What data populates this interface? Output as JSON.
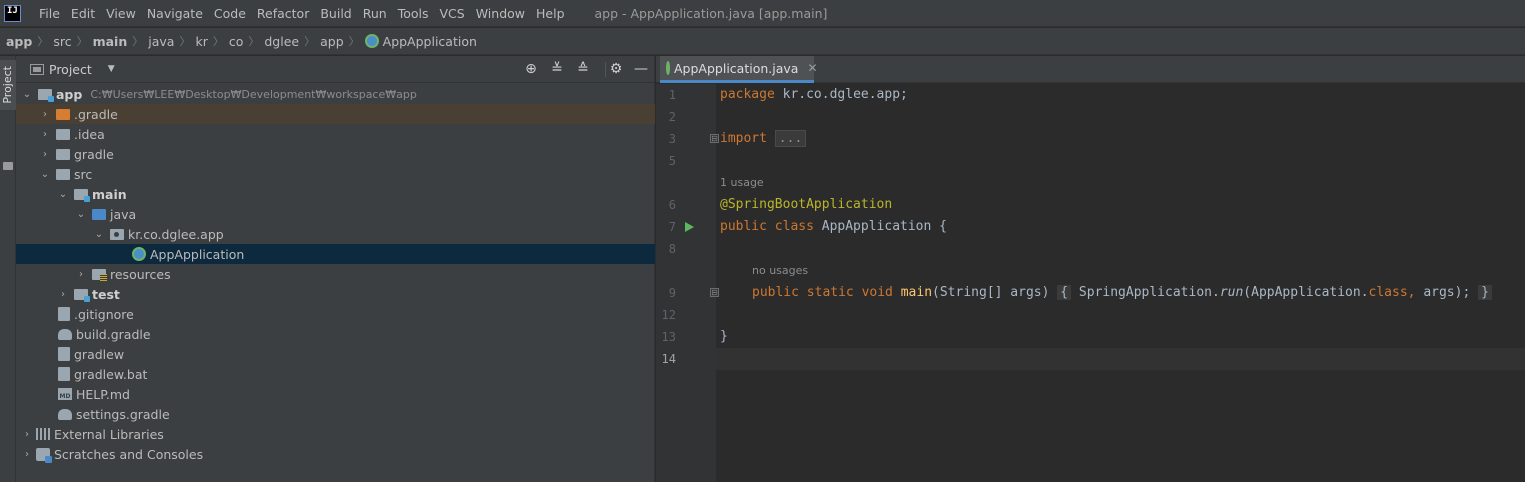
{
  "menubar": {
    "logo": "IJ",
    "items": [
      "File",
      "Edit",
      "View",
      "Navigate",
      "Code",
      "Refactor",
      "Build",
      "Run",
      "Tools",
      "VCS",
      "Window",
      "Help"
    ],
    "window_title": "app - AppApplication.java [app.main]"
  },
  "breadcrumb": [
    "app",
    "src",
    "main",
    "java",
    "kr",
    "co",
    "dglee",
    "app",
    "AppApplication"
  ],
  "left_strip": {
    "label": "Project"
  },
  "project_panel": {
    "title": "Project",
    "tree": [
      {
        "label": "app",
        "hint": "C:₩Users₩LEE₩Desktop₩Development₩workspace₩app"
      },
      {
        "label": ".gradle"
      },
      {
        "label": ".idea"
      },
      {
        "label": "gradle"
      },
      {
        "label": "src"
      },
      {
        "label": "main"
      },
      {
        "label": "java"
      },
      {
        "label": "kr.co.dglee.app"
      },
      {
        "label": "AppApplication"
      },
      {
        "label": "resources"
      },
      {
        "label": "test"
      },
      {
        "label": ".gitignore"
      },
      {
        "label": "build.gradle"
      },
      {
        "label": "gradlew"
      },
      {
        "label": "gradlew.bat"
      },
      {
        "label": "HELP.md"
      },
      {
        "label": "settings.gradle"
      },
      {
        "label": "External Libraries"
      },
      {
        "label": "Scratches and Consoles"
      }
    ]
  },
  "editor": {
    "tab_label": "AppApplication.java",
    "line_numbers": [
      "1",
      "2",
      "3",
      "5",
      "6",
      "7",
      "8",
      "9",
      "12",
      "13",
      "14"
    ],
    "hints": {
      "class_usage": "1 usage",
      "method_usage": "no usages"
    },
    "code": {
      "l1_kw": "package",
      "l1_rest": " kr.co.dglee.app;",
      "l3_kw": "import",
      "l3_fold": "...",
      "l6": "@SpringBootApplication",
      "l7_kw": "public class",
      "l7_rest": " AppApplication {",
      "l9_kw": "public static void",
      "l9_meth": " main",
      "l9_args": "(String[] args)",
      "l9_open": "{",
      "l9_body1": " SpringApplication.",
      "l9_run": "run",
      "l9_body2": "(AppApplication.",
      "l9_class": "class",
      "l9_comma": ",",
      "l9_body3": " args);",
      "l9_close": "}",
      "l13": "}"
    }
  }
}
